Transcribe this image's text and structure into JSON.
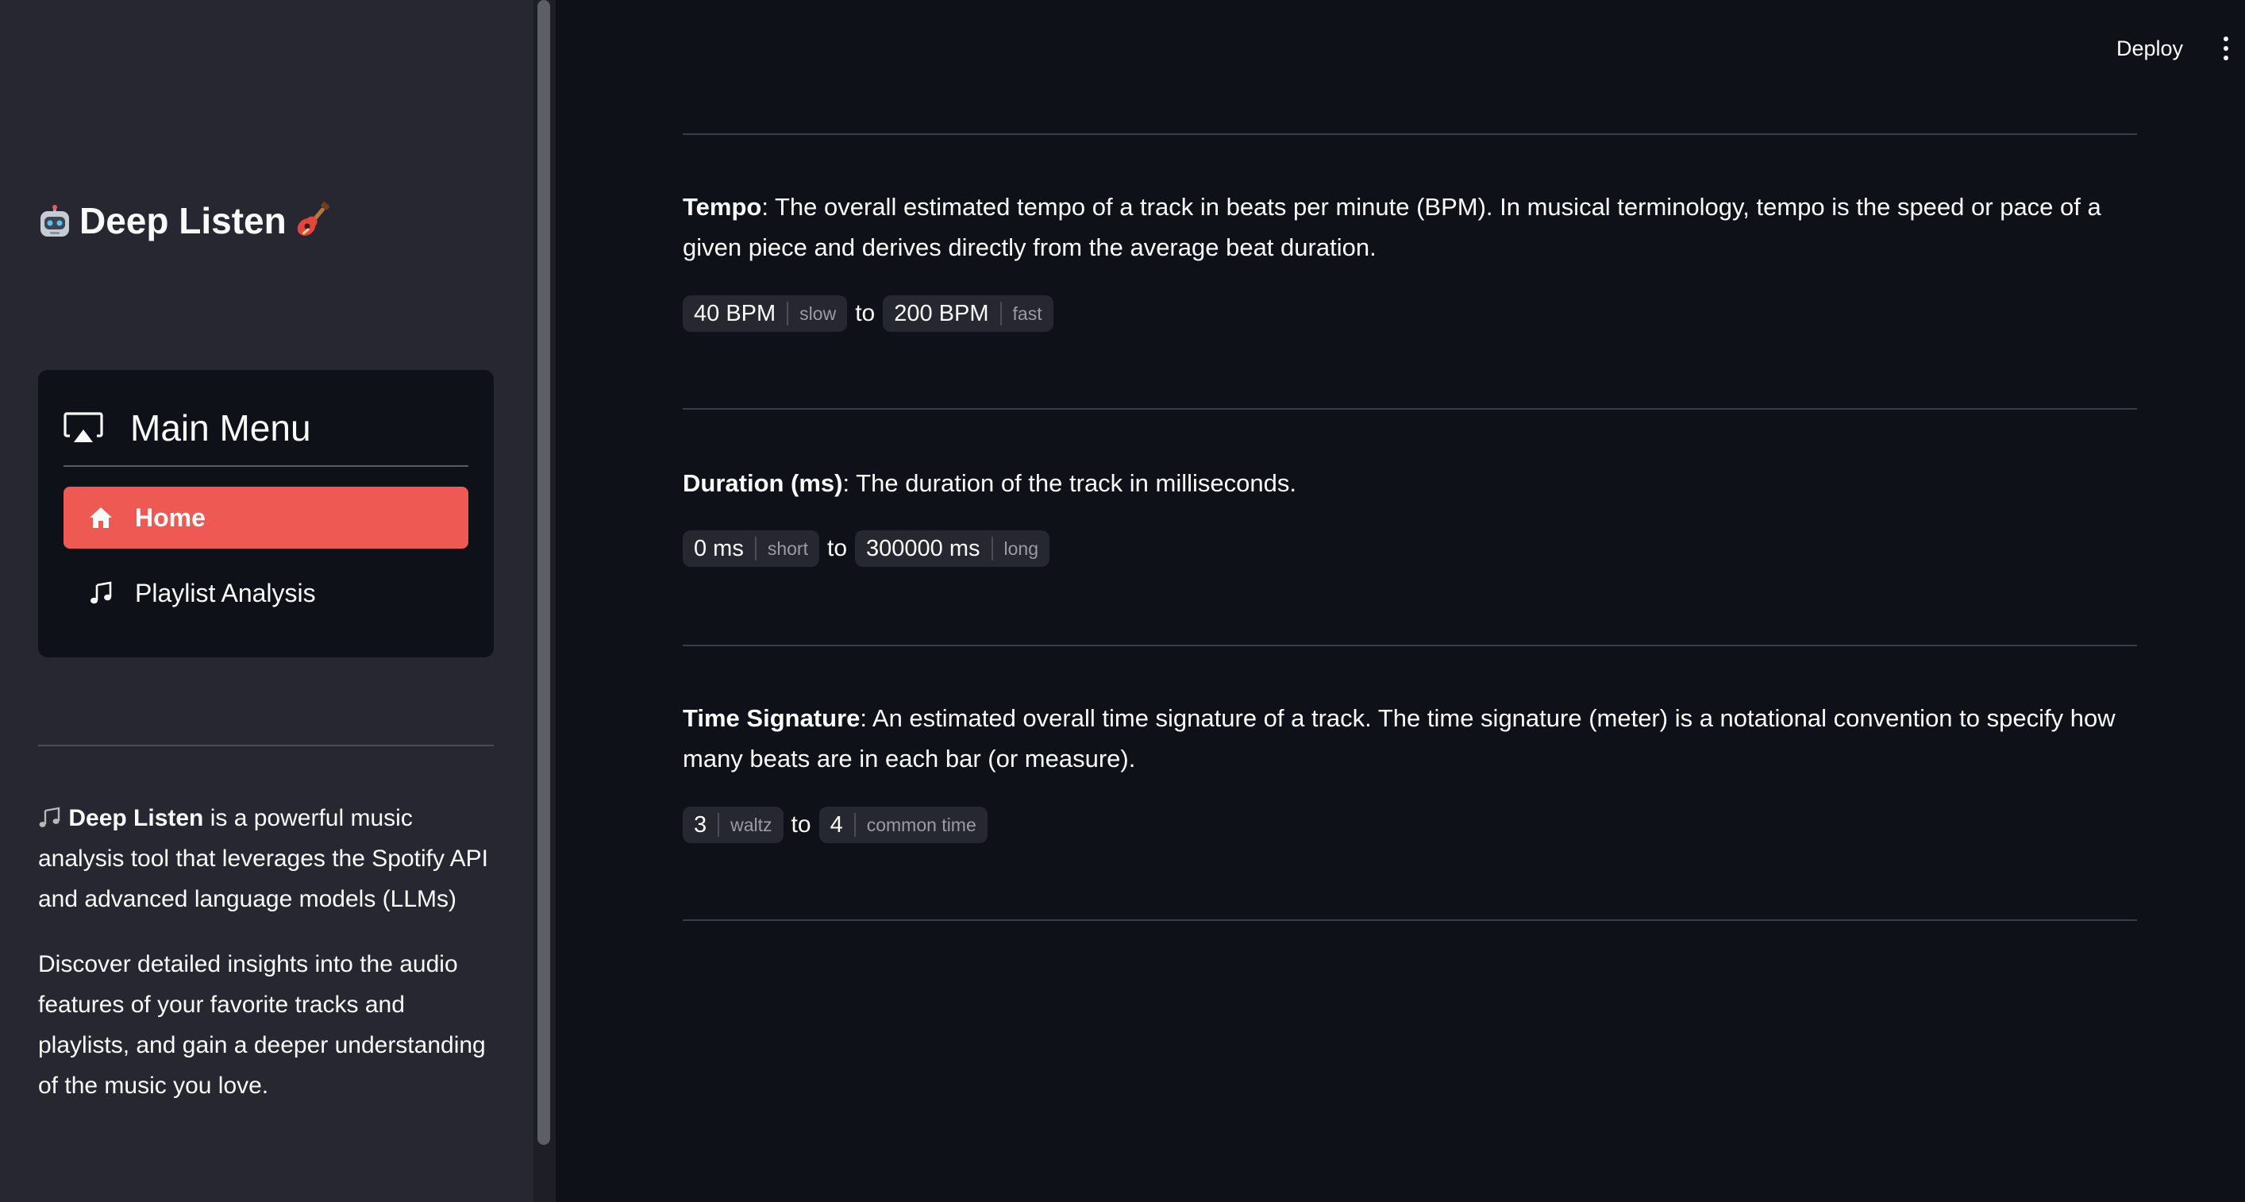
{
  "sidebar": {
    "app_title": "Deep Listen",
    "menu": {
      "title": "Main Menu",
      "items": [
        {
          "label": "Home",
          "active": true,
          "icon": "house-icon"
        },
        {
          "label": "Playlist Analysis",
          "active": false,
          "icon": "music-note-icon"
        }
      ]
    },
    "about_strong": "Deep Listen",
    "about_rest": " is a powerful music analysis tool that leverages the Spotify API and advanced language models (LLMs)",
    "discover": "Discover detailed insights into the audio features of your favorite tracks and playlists, and gain a deeper understanding of the music you love."
  },
  "header": {
    "deploy_label": "Deploy"
  },
  "features": [
    {
      "name": "Tempo",
      "description": ": The overall estimated tempo of a track in beats per minute (BPM). In musical terminology, tempo is the speed or pace of a given piece and derives directly from the average beat duration.",
      "min_value": "40 BPM",
      "min_tag": "slow",
      "to": "to",
      "max_value": "200 BPM",
      "max_tag": "fast"
    },
    {
      "name": "Duration (ms)",
      "description": ": The duration of the track in milliseconds.",
      "min_value": "0 ms",
      "min_tag": "short",
      "to": "to",
      "max_value": "300000 ms",
      "max_tag": "long"
    },
    {
      "name": "Time Signature",
      "description": ": An estimated overall time signature of a track. The time signature (meter) is a notational convention to specify how many beats are in each bar (or measure).",
      "min_value": "3",
      "min_tag": "waltz",
      "to": "to",
      "max_value": "4",
      "max_tag": "common time"
    }
  ],
  "colors": {
    "accent": "#ee5a53",
    "sidebar_bg": "#262730",
    "main_bg": "#0e1117"
  }
}
